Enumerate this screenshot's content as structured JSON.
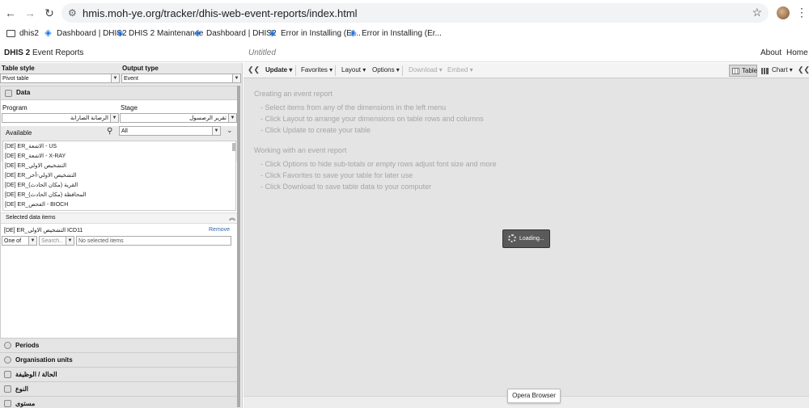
{
  "browser": {
    "url": "hmis.moh-ye.org/tracker/dhis-web-event-reports/index.html",
    "back": "←",
    "forward": "→",
    "reload": "↻",
    "star": "☆",
    "menu": "⋮",
    "bookmarks": [
      "dhis2",
      "Dashboard | DHIS2",
      "DHIS 2 Maintenance",
      "Dashboard | DHIS2",
      "Error in Installing (Er...",
      "Error in Installing (Er..."
    ]
  },
  "header": {
    "brand": "DHIS 2",
    "title": "Event Reports",
    "untitled": "Untitled",
    "about": "About",
    "home": "Home"
  },
  "left": {
    "table_style_label": "Table style",
    "table_style_value": "Pivot table",
    "output_type_label": "Output type",
    "output_type_value": "Event",
    "data_title": "Data",
    "program_label": "Program",
    "program_value": "الرصانة الصارانة",
    "stage_label": "Stage",
    "stage_value": "تقرير الرصسول",
    "available_label": "Available",
    "available_filter": "All",
    "available_items": [
      "[DE] ER_الاشعة - US",
      "[DE] ER_الاشعة - X-RAY",
      "[DE] ER_التشخيص الاولي",
      "[DE] ER_التشخيص الاولي-آخر",
      "[DE] ER_القرية (مكان الحادث)",
      "[DE] ER_المحافظة (مكان الحادث)",
      "[DE] ER_الفحص - BIOCH"
    ],
    "selected_label": "Selected data items",
    "selected_item": "[DE] ER_التشخيص الاولي ICD11",
    "remove": "Remove",
    "op_value": "One of",
    "search_placeholder": "Search..",
    "no_selected": "No selected items",
    "sections": [
      "Periods",
      "Organisation units",
      "الحالة / الوظيفة",
      "النوع",
      "مستوى"
    ]
  },
  "toolbar": {
    "update": "Update",
    "favorites": "Favorites",
    "layout": "Layout",
    "options": "Options",
    "download": "Download",
    "embed": "Embed",
    "table": "Table",
    "chart": "Chart"
  },
  "help": {
    "heading1": "Creating an event report",
    "items1": [
      "- Select items from any of the dimensions in the left menu",
      "- Click Layout to arrange your dimensions on table rows and columns",
      "- Click Update to create your table"
    ],
    "heading2": "Working with an event report",
    "items2": [
      "- Click Options to hide sub-totals or empty rows adjust font size and more",
      "- Click Favorites to save your table for later use",
      "- Click Download to save table data to your computer"
    ]
  },
  "loading": "Loading...",
  "badge": "Opera Browser"
}
